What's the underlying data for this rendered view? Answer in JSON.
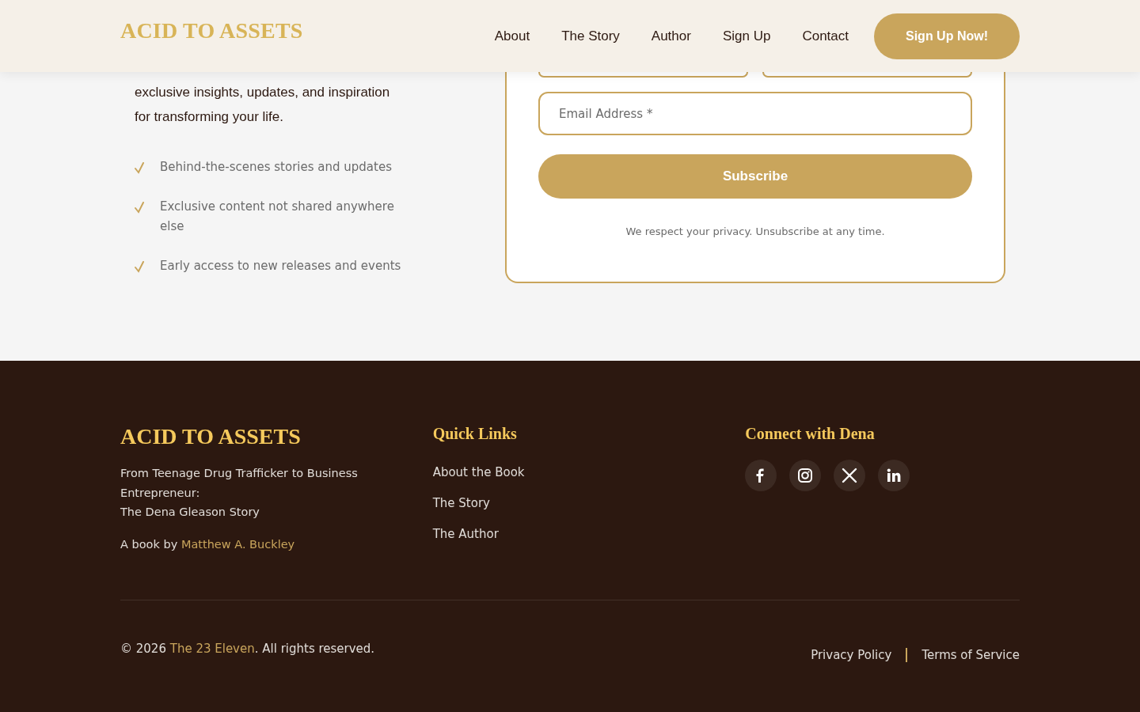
{
  "header": {
    "logo": "ACID TO ASSETS",
    "nav": [
      "About",
      "The Story",
      "Author",
      "Sign Up",
      "Contact"
    ],
    "cta": "Sign Up Now!"
  },
  "signup": {
    "intro": "exclusive insights, updates, and inspiration for transforming your life.",
    "benefits": [
      "Behind-the-scenes stories and updates",
      "Exclusive content not shared anywhere else",
      "Early access to new releases and events"
    ],
    "form": {
      "email": {
        "placeholder": "Email Address *"
      },
      "button": "Subscribe",
      "note": "We respect your privacy. Unsubscribe at any time."
    }
  },
  "footer": {
    "logo": "ACID TO ASSETS",
    "description": [
      "From Teenage Drug Trafficker to Business Entrepreneur:",
      "The Dena Gleason Story"
    ],
    "credit": {
      "prefix": "A book by ",
      "link": "Matthew A. Buckley"
    },
    "quick_links": {
      "heading": "Quick Links",
      "links": [
        "About the Book",
        "The Story",
        "The Author"
      ]
    },
    "connect": {
      "heading": "Connect with Dena",
      "socials": [
        {
          "kind": "facebook"
        },
        {
          "kind": "instagram"
        },
        {
          "kind": "x"
        },
        {
          "kind": "linkedin"
        }
      ]
    },
    "copyright": {
      "prefix": "© 2026 ",
      "link": "The 23 Eleven",
      "suffix": ". All rights reserved."
    },
    "legal_links": [
      "Privacy Policy",
      "Terms of Service"
    ]
  }
}
